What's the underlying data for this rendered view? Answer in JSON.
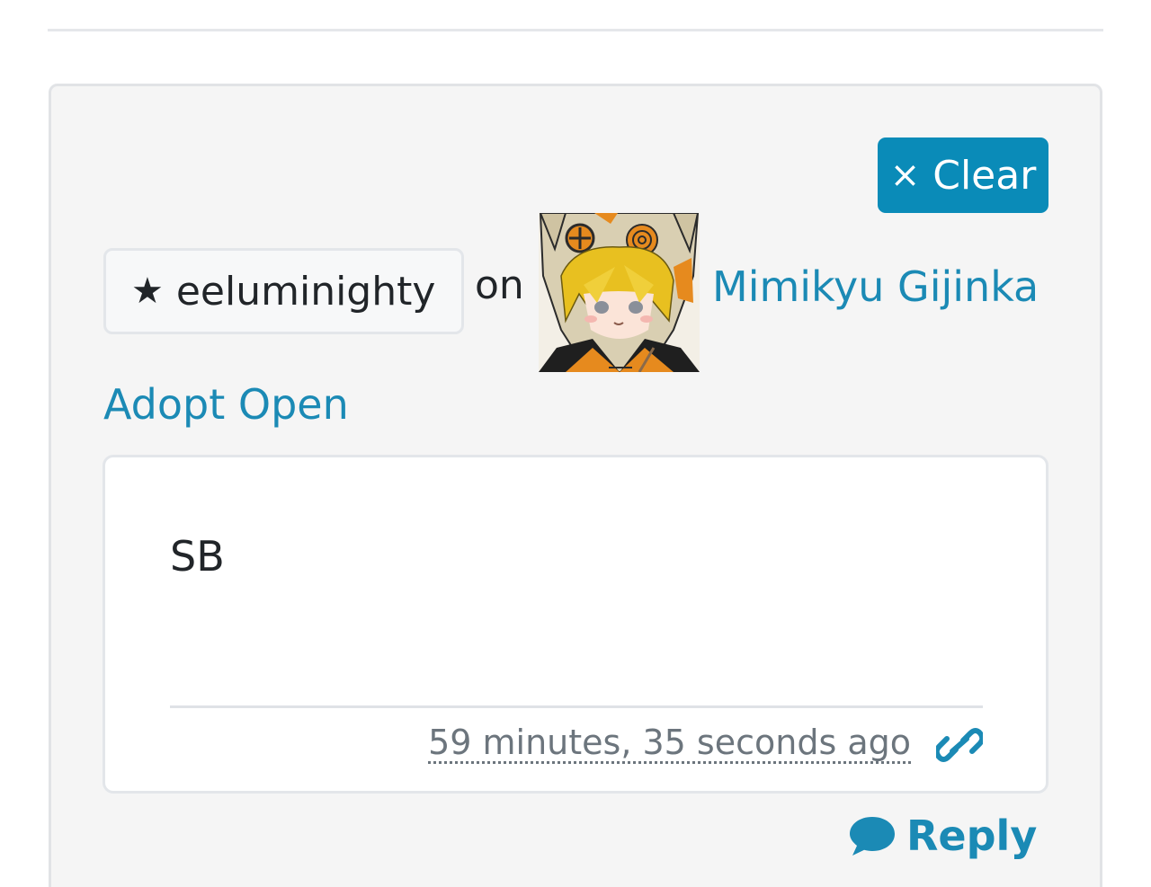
{
  "toolbar": {
    "clear_label": "Clear",
    "clear_icon": "×"
  },
  "comment": {
    "author": "eeluminighty",
    "author_icon": "★",
    "connector": "on",
    "character_name": "Mimikyu Gijinka",
    "character_status": "Adopt Open",
    "text": "SB",
    "timestamp": "59 minutes, 35 seconds ago",
    "permalink_icon": "link-icon"
  },
  "actions": {
    "reply_label": "Reply",
    "reply_icon": "comment-icon"
  },
  "colors": {
    "accent": "#1b8ab5",
    "button_bg": "#0a8bb8",
    "card_bg": "#f5f5f5",
    "muted": "#6c757d"
  }
}
